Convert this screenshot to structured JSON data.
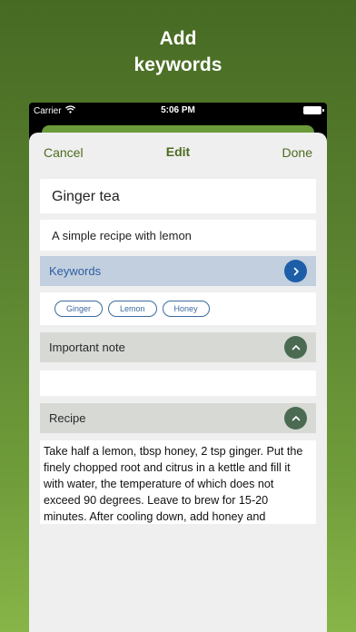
{
  "headline": {
    "line1": "Add",
    "line2": "keywords"
  },
  "status": {
    "carrier": "Carrier",
    "time": "5:06 PM"
  },
  "nav": {
    "cancel": "Cancel",
    "title": "Edit",
    "done": "Done"
  },
  "recipe": {
    "title": "Ginger tea",
    "description": "A simple recipe with lemon",
    "note": "",
    "text": "Take half a lemon, tbsp honey, 2 tsp ginger. Put the finely chopped root and citrus in a kettle and fill it with water, the temperature of which does not exceed 90 degrees. Leave to brew for 15-20 minutes. After cooling down, add honey and"
  },
  "sections": {
    "keywords": "Keywords",
    "note": "Important note",
    "recipe": "Recipe"
  },
  "keywords": [
    "Ginger",
    "Lemon",
    "Honey"
  ],
  "icons": {
    "wifi": "wifi-icon",
    "battery": "battery-icon",
    "keywords_button": "chevron-right-icon",
    "note_button": "chevron-up-icon",
    "recipe_button": "chevron-up-icon"
  },
  "colors": {
    "accent": "#4d6b1f",
    "keywords_blue": "#1d5ea8",
    "section_green": "#4a6b52"
  }
}
